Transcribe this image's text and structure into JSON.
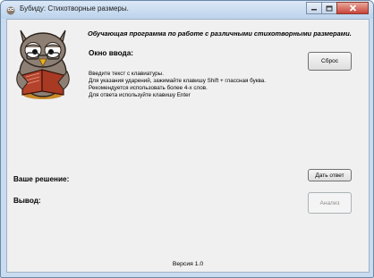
{
  "window": {
    "title": "Бубиду: Стихотворные размеры."
  },
  "header": {
    "subtitle": "Обучающая программа по работе с различными стихотворными размерами."
  },
  "input_area": {
    "label": "Окно ввода:",
    "hints": [
      "Введите текст с клавиатуры.",
      "Для указания ударений, зажимайте клавишу Shift + глассная буква.",
      "Рекомендуется использовать более 4-х слов.",
      "Для ответа используйте клавишу Enter"
    ]
  },
  "buttons": {
    "reset": "Сброс",
    "answer": "Дать ответ",
    "analyze": "Анализ"
  },
  "labels": {
    "solution": "Ваше решение:",
    "output": "Вывод:"
  },
  "footer": {
    "version": "Версия 1.0"
  }
}
